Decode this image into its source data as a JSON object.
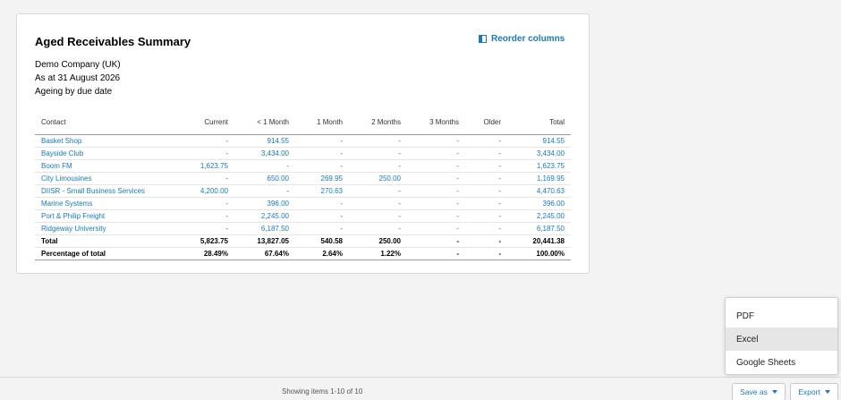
{
  "report": {
    "title": "Aged Receivables Summary",
    "reorder_label": "Reorder columns",
    "company": "Demo Company (UK)",
    "as_at": "As at 31 August 2026",
    "ageing": "Ageing by due date"
  },
  "table": {
    "headers": [
      "Contact",
      "Current",
      "< 1 Month",
      "1 Month",
      "2 Months",
      "3 Months",
      "Older",
      "Total"
    ],
    "rows": [
      [
        "Basket Shop",
        "-",
        "914.55",
        "-",
        "-",
        "-",
        "-",
        "914.55"
      ],
      [
        "Bayside Club",
        "-",
        "3,434.00",
        "-",
        "-",
        "-",
        "-",
        "3,434.00"
      ],
      [
        "Boom FM",
        "1,623.75",
        "-",
        "-",
        "-",
        "-",
        "-",
        "1,623.75"
      ],
      [
        "City Limousines",
        "-",
        "650.00",
        "269.95",
        "250.00",
        "-",
        "-",
        "1,169.95"
      ],
      [
        "DIISR - Small Business Services",
        "4,200.00",
        "-",
        "270.63",
        "-",
        "-",
        "-",
        "4,470.63"
      ],
      [
        "Marine Systems",
        "-",
        "396.00",
        "-",
        "-",
        "-",
        "-",
        "396.00"
      ],
      [
        "Port & Philip Freight",
        "-",
        "2,245.00",
        "-",
        "-",
        "-",
        "-",
        "2,245.00"
      ],
      [
        "Ridgeway University",
        "-",
        "6,187.50",
        "-",
        "-",
        "-",
        "-",
        "6,187.50"
      ]
    ],
    "total": [
      "Total",
      "5,823.75",
      "13,827.05",
      "540.58",
      "250.00",
      "-",
      "-",
      "20,441.38"
    ],
    "percentage": [
      "Percentage of total",
      "28.49%",
      "67.64%",
      "2.64%",
      "1.22%",
      "-",
      "-",
      "100.00%"
    ]
  },
  "footer": {
    "pagination": "Showing items 1-10 of 10",
    "save_as_label": "Save as",
    "export_label": "Export"
  },
  "export_menu": {
    "items": [
      "PDF",
      "Excel",
      "Google Sheets"
    ],
    "hovered_index": 1
  },
  "icons": {
    "reorder": "columns-icon",
    "caret": "chevron-down-icon"
  },
  "colors": {
    "link": "#1a7ab9",
    "background": "#f3f3f3",
    "card": "#ffffff"
  }
}
